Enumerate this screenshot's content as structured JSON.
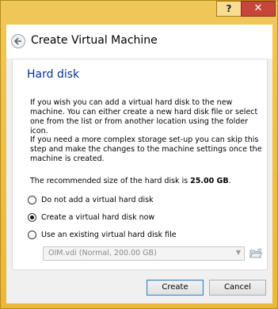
{
  "window": {
    "help_label": "?",
    "close_label": "✕"
  },
  "wizard": {
    "title": "Create Virtual Machine",
    "back_icon": "back-arrow-icon"
  },
  "page": {
    "section_title": "Hard disk",
    "intro_text": "If you wish you can add a virtual hard disk to the new machine. You can either create a new hard disk file or select one from the list or from another location using the folder icon.",
    "complex_text": "If you need a more complex storage set-up you can skip this step and make the changes to the machine settings once the machine is created.",
    "recommended_prefix": "The recommended size of the hard disk is ",
    "recommended_size": "25.00 GB",
    "recommended_suffix": "."
  },
  "options": [
    {
      "label": "Do not add a virtual hard disk",
      "checked": false
    },
    {
      "label": "Create a virtual hard disk now",
      "checked": true
    },
    {
      "label": "Use an existing virtual hard disk file",
      "checked": false
    }
  ],
  "disk_select": {
    "value": "OIM.vdi (Normal, 200.00 GB)",
    "disabled": true,
    "folder_icon": "folder-open-icon"
  },
  "buttons": {
    "create": "Create",
    "cancel": "Cancel"
  }
}
